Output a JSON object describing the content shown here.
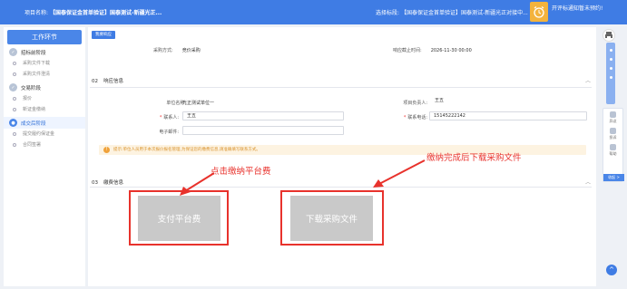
{
  "topbar": {
    "project_label": "项目名称:",
    "project_name": "【国泰保证金首单验证】国泰测试-新疆光正...",
    "section_label": "选择标段:",
    "section_name": "【国泰保证金首单验证】国泰测试-新疆光正对接中...",
    "notice": "开评标通知暂未预约!"
  },
  "sidebar": {
    "title": "工作环节",
    "stages": [
      {
        "label": "招标前阶段",
        "subs": [
          "采购文件下载",
          "采购文件澄清"
        ]
      },
      {
        "label": "交易阶段",
        "subs": [
          "报价",
          "新证金缴纳"
        ]
      },
      {
        "label": "成交后阶段",
        "subs": [
          "提交履约保证金",
          "合同签署"
        ]
      }
    ]
  },
  "main": {
    "tag": "我要响应",
    "purchase_method_label": "采购方式:",
    "purchase_method": "竞价采购",
    "deadline_label": "响应截止时间:",
    "deadline": "2026-11-30 00:00",
    "section02": {
      "num": "02",
      "title": "响应信息"
    },
    "section03": {
      "num": "03",
      "title": "缴费信息"
    },
    "form": {
      "unit_label": "单位名称:",
      "unit_value": "光正测试单位一",
      "manager_label": "项目负责人:",
      "manager_value": "王五",
      "contact_label": "联系人:",
      "contact_value": "王五",
      "phone_label": "联系电话:",
      "phone_value": "15145222142",
      "email_label": "电子邮件:",
      "email_value": ""
    },
    "warning": "提示:单位人员用于本次报价报名管理,为保证您的缴费信息,请准确填写联系方式。"
  },
  "annotations": {
    "pay_hint": "点击缴纳平台费",
    "download_hint": "缴纳完成后下载采购文件"
  },
  "buttons": {
    "pay": "支付平台费",
    "download": "下载采购文件"
  },
  "rail": {
    "items": [
      "异议",
      "投诉",
      "帮助"
    ],
    "collapse": "收起 >"
  },
  "colors": {
    "brand": "#3f7ce4",
    "annotation": "#e8322c",
    "warning_bg": "#fdf3e1"
  }
}
